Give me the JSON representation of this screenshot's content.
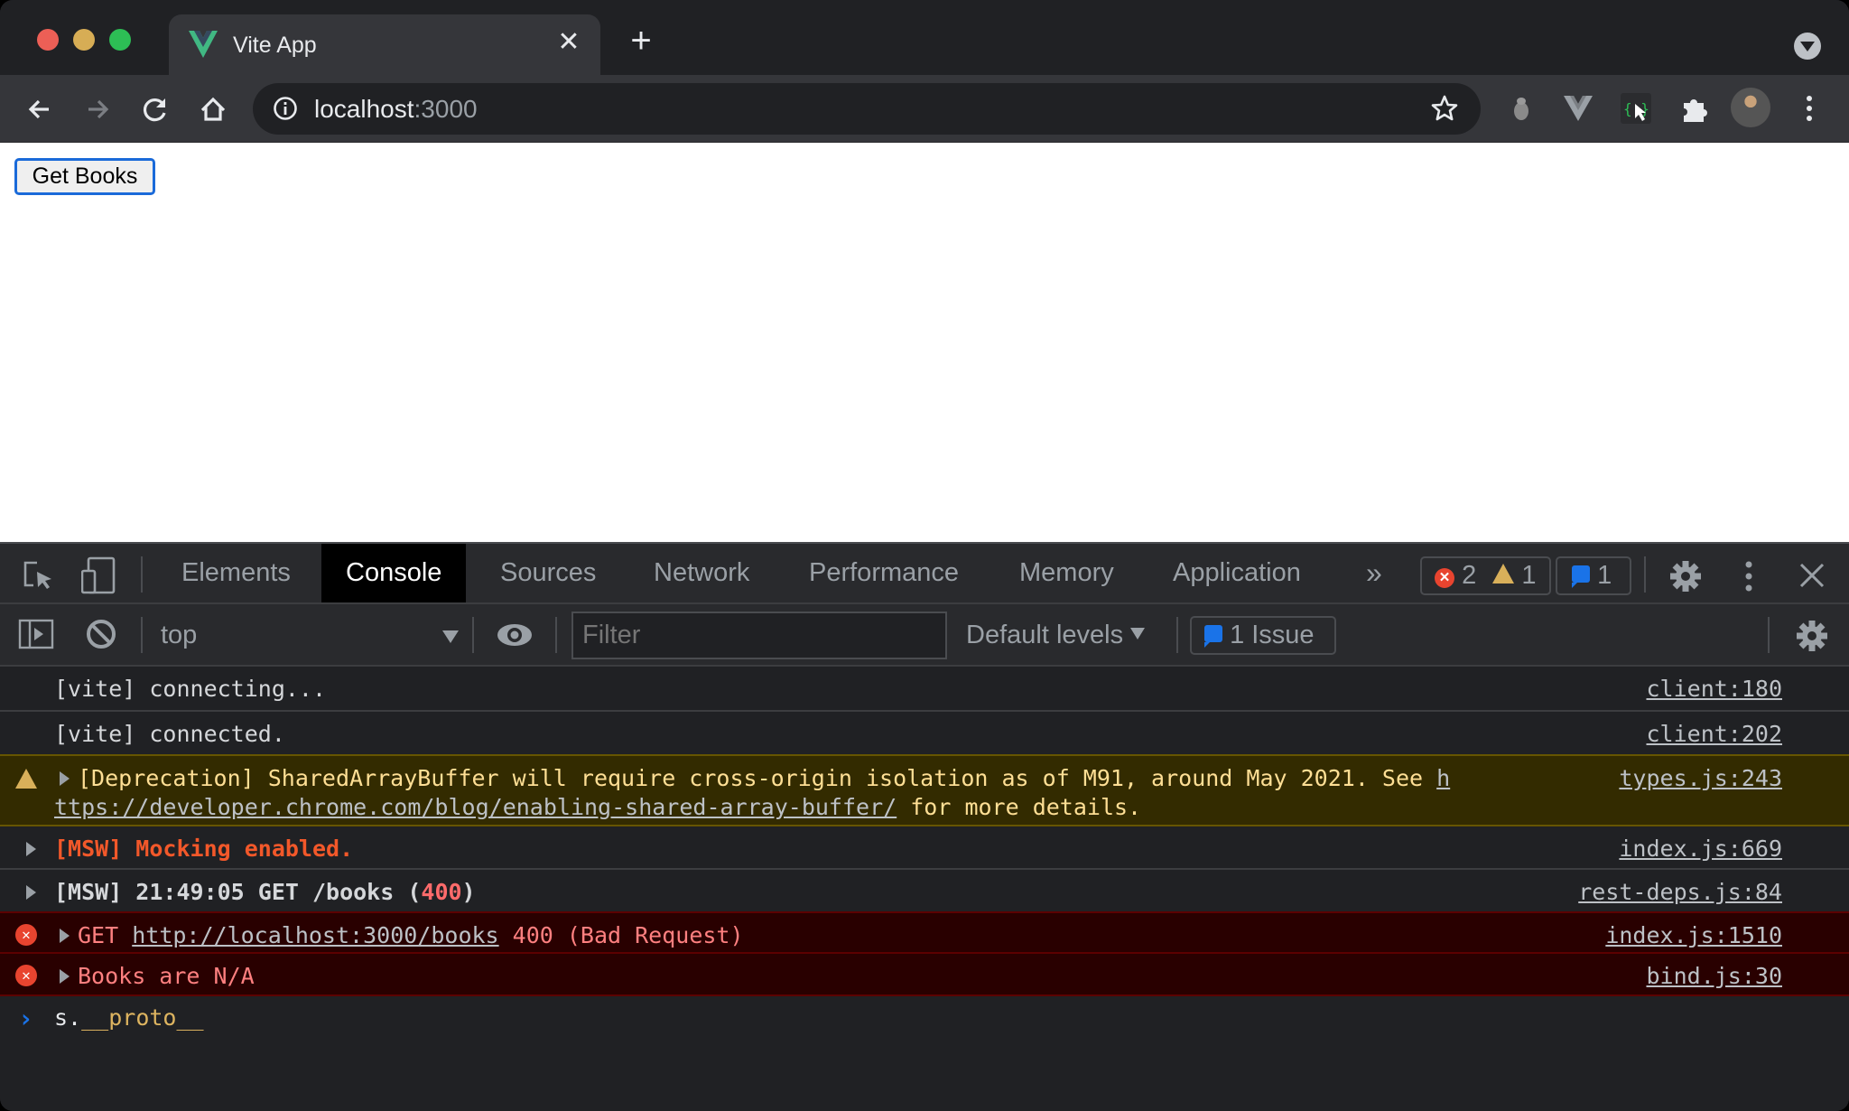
{
  "browser": {
    "tab": {
      "title": "Vite App",
      "favicon": "vue-logo-icon"
    },
    "new_tab_label": "+",
    "omnibox": {
      "host": "localhost",
      "port": ":3000"
    },
    "extensions": [
      "bug-extension-icon",
      "vue-devtools-icon",
      "json-viewer-icon",
      "extensions-puzzle-icon"
    ],
    "accent": "#1a73e8"
  },
  "page": {
    "get_books_label": "Get Books"
  },
  "devtools": {
    "tabs": [
      {
        "label": "Elements",
        "active": false
      },
      {
        "label": "Console",
        "active": true
      },
      {
        "label": "Sources",
        "active": false
      },
      {
        "label": "Network",
        "active": false
      },
      {
        "label": "Performance",
        "active": false
      },
      {
        "label": "Memory",
        "active": false
      },
      {
        "label": "Application",
        "active": false
      }
    ],
    "more_tabs_label": "»",
    "counters": {
      "errors": "2",
      "warnings": "1",
      "messages": "1"
    },
    "filterbar": {
      "context": "top",
      "filter_placeholder": "Filter",
      "levels": "Default levels",
      "issues_label": "1 Issue"
    },
    "console": {
      "rows": [
        {
          "type": "log",
          "text": "[vite] connecting...",
          "source": "client:180"
        },
        {
          "type": "log",
          "text": "[vite] connected.",
          "source": "client:202"
        },
        {
          "type": "warning",
          "text_line1": "[Deprecation] SharedArrayBuffer will require cross-origin isolation as of M91, around May 2021. See ",
          "link_part1": "h",
          "link_part2": "ttps://developer.chrome.com/blog/enabling-shared-array-buffer/",
          "text_line2_suffix": " for more details.",
          "source": "types.js:243"
        },
        {
          "type": "log",
          "text": "[MSW] Mocking enabled.",
          "source": "index.js:669"
        },
        {
          "type": "log",
          "text_prefix": "[MSW] 21:49:05 GET /books (",
          "status": "400",
          "text_suffix": ")",
          "source": "rest-deps.js:84"
        },
        {
          "type": "error",
          "text_prefix": "GET ",
          "url": "http://localhost:3000/books",
          "text_suffix": " 400 (Bad Request)",
          "source": "index.js:1510"
        },
        {
          "type": "error",
          "text": "Books are N/A",
          "source": "bind.js:30"
        }
      ],
      "prompt": {
        "object": "s.",
        "property": "__proto__"
      }
    }
  }
}
